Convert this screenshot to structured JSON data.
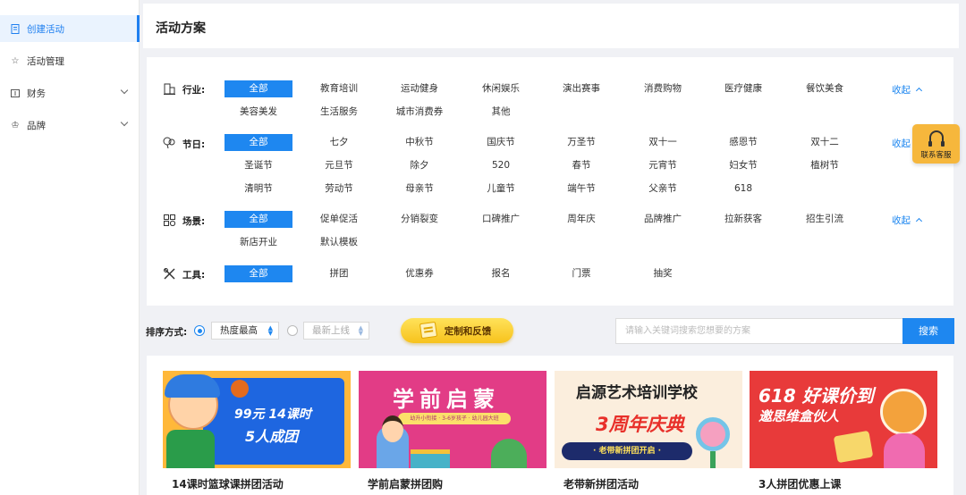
{
  "sidebar": {
    "items": [
      {
        "label": "创建活动",
        "icon": "file-icon",
        "active": true
      },
      {
        "label": "活动管理",
        "icon": "star-icon"
      },
      {
        "label": "财务",
        "icon": "wallet-icon",
        "expandable": true
      },
      {
        "label": "品牌",
        "icon": "crown-icon",
        "expandable": true
      }
    ]
  },
  "header": {
    "title": "活动方案"
  },
  "filters": {
    "industry": {
      "label": "行业:",
      "tags": [
        "全部",
        "教育培训",
        "运动健身",
        "休闲娱乐",
        "演出赛事",
        "消费购物",
        "医疗健康",
        "餐饮美食",
        "美容美发",
        "生活服务",
        "城市消费券",
        "其他"
      ],
      "collapse": "收起"
    },
    "holiday": {
      "label": "节日:",
      "tags": [
        "全部",
        "七夕",
        "中秋节",
        "国庆节",
        "万圣节",
        "双十一",
        "感恩节",
        "双十二",
        "圣诞节",
        "元旦节",
        "除夕",
        "520",
        "春节",
        "元宵节",
        "妇女节",
        "植树节",
        "清明节",
        "劳动节",
        "母亲节",
        "儿童节",
        "端午节",
        "父亲节",
        "618"
      ],
      "collapse": "收起"
    },
    "scene": {
      "label": "场景:",
      "tags": [
        "全部",
        "促单促活",
        "分销裂变",
        "口碑推广",
        "周年庆",
        "品牌推广",
        "拉新获客",
        "招生引流",
        "新店开业",
        "默认模板"
      ],
      "collapse": "收起"
    },
    "tool": {
      "label": "工具:",
      "tags": [
        "全部",
        "拼团",
        "优惠券",
        "报名",
        "门票",
        "抽奖"
      ]
    }
  },
  "sort": {
    "label": "排序方式:",
    "option1": "热度最高",
    "option2": "最新上线",
    "feedback": "定制和反馈"
  },
  "search": {
    "placeholder": "请输入关键词搜索您想要的方案",
    "button": "搜索"
  },
  "service": {
    "label": "联系客服"
  },
  "cards": [
    {
      "title": "14课时篮球课拼团活动",
      "line1": "99元 14课时",
      "line2": "5人成团"
    },
    {
      "title": "学前启蒙拼团购",
      "line1": "学前启蒙",
      "line2": "幼升小衔接 · 3-6岁孩子 · 幼儿园大班"
    },
    {
      "title": "老带新拼团活动",
      "line1": "启源艺术培训学校",
      "line2": "3周年庆典",
      "line3": "· 老带新拼团开启 ·"
    },
    {
      "title": "3人拼团优惠上课",
      "line1": "618 好课价到",
      "line2": "邀思维盒伙人"
    }
  ],
  "colors": {
    "primary": "#1e87f0",
    "service": "#f6b73c",
    "feedback": "#f7c21c"
  }
}
